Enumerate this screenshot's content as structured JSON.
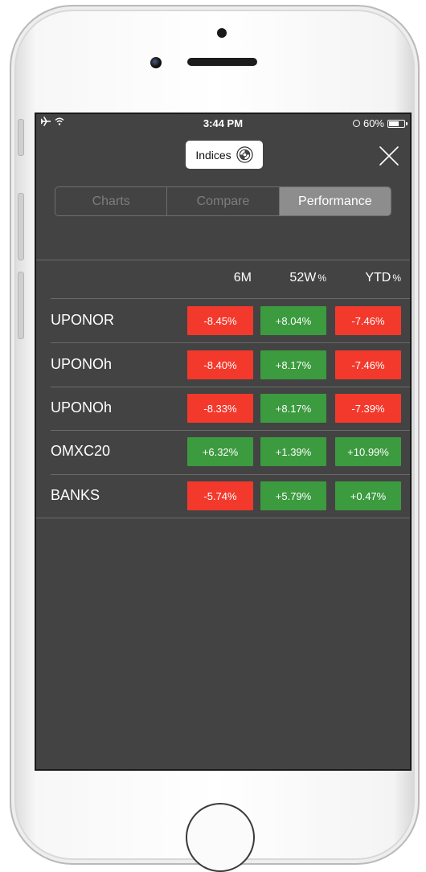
{
  "colors": {
    "negative": "#f2392c",
    "positive": "#3c9a3f",
    "screen_bg": "#434343"
  },
  "status_bar": {
    "time": "3:44 PM",
    "battery": "60%",
    "icons": [
      "airplane-icon",
      "wifi-icon",
      "orientation-lock-icon",
      "battery-icon"
    ]
  },
  "header": {
    "indices_label": "Indices",
    "indices_icon": "disc-icon",
    "close_icon": "close-icon"
  },
  "tabs": [
    {
      "label": "Charts",
      "active": false
    },
    {
      "label": "Compare",
      "active": false
    },
    {
      "label": "Performance",
      "active": true
    }
  ],
  "table": {
    "columns": [
      {
        "label": "6M",
        "unit": ""
      },
      {
        "label": "52W",
        "unit": "%"
      },
      {
        "label": "YTD",
        "unit": "%"
      }
    ],
    "rows": [
      {
        "name": "UPONOR",
        "values": [
          "-8.45%",
          "+8.04%",
          "-7.46%"
        ]
      },
      {
        "name": "UPONOh",
        "values": [
          "-8.40%",
          "+8.17%",
          "-7.46%"
        ]
      },
      {
        "name": "UPONOh",
        "values": [
          "-8.33%",
          "+8.17%",
          "-7.39%"
        ]
      },
      {
        "name": "OMXC20",
        "values": [
          "+6.32%",
          "+1.39%",
          "+10.99%"
        ]
      },
      {
        "name": "BANKS",
        "values": [
          "-5.74%",
          "+5.79%",
          "+0.47%"
        ]
      }
    ]
  }
}
